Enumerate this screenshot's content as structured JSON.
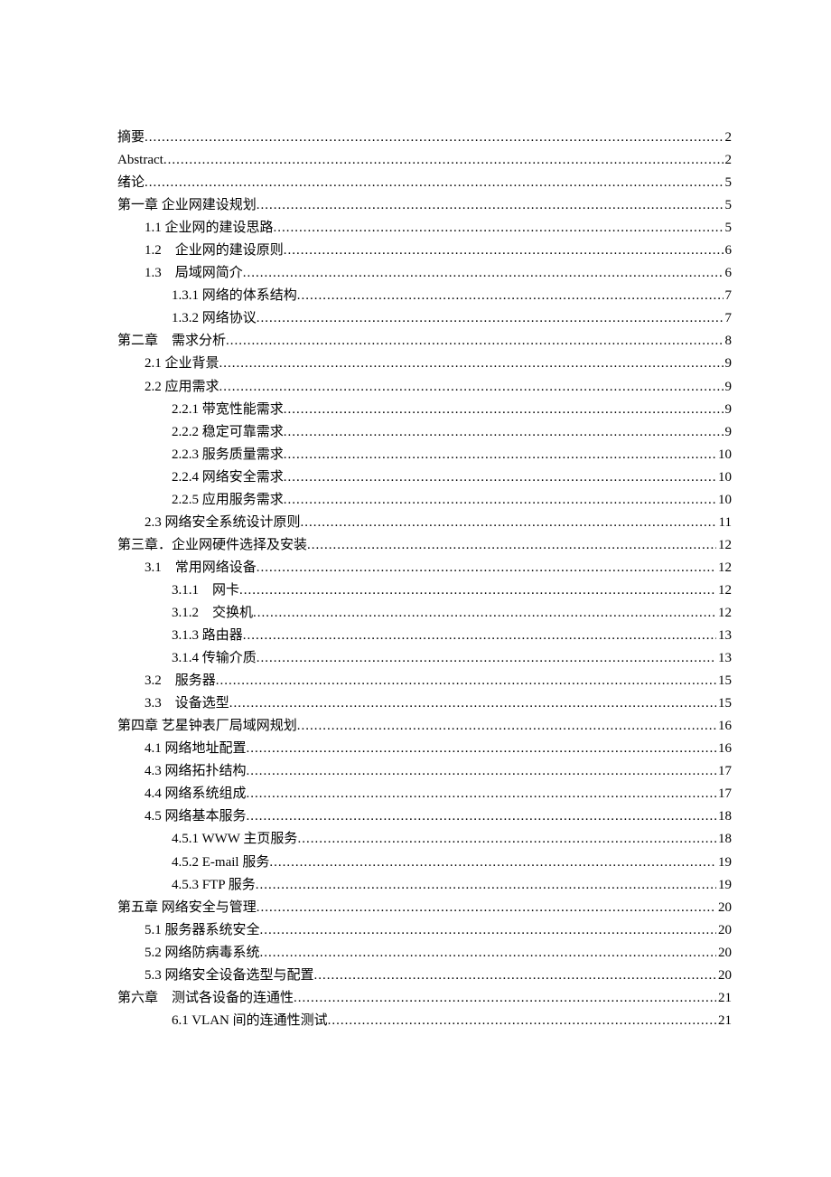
{
  "toc": [
    {
      "level": 0,
      "title": "摘要",
      "page": "2"
    },
    {
      "level": 0,
      "title": "Abstract",
      "page": "2"
    },
    {
      "level": 0,
      "title": "绪论",
      "page": "5"
    },
    {
      "level": 0,
      "title": "第一章 企业网建设规划",
      "page": "5"
    },
    {
      "level": 1,
      "title": "1.1 企业网的建设思路",
      "page": "5"
    },
    {
      "level": 1,
      "title": "1.2　企业网的建设原则",
      "page": "6"
    },
    {
      "level": 1,
      "title": "1.3　局域网简介",
      "page": "6"
    },
    {
      "level": 2,
      "title": "1.3.1 网络的体系结构",
      "page": "7"
    },
    {
      "level": 2,
      "title": "1.3.2 网络协议",
      "page": "7"
    },
    {
      "level": 0,
      "title": "第二章　需求分析",
      "page": "8"
    },
    {
      "level": 1,
      "title": "2.1 企业背景",
      "page": "9"
    },
    {
      "level": 1,
      "title": "2.2 应用需求",
      "page": "9"
    },
    {
      "level": 2,
      "title": "2.2.1 带宽性能需求",
      "page": "9"
    },
    {
      "level": 2,
      "title": "2.2.2 稳定可靠需求",
      "page": "9"
    },
    {
      "level": 2,
      "title": "2.2.3 服务质量需求",
      "page": "10"
    },
    {
      "level": 2,
      "title": "2.2.4 网络安全需求",
      "page": "10"
    },
    {
      "level": 2,
      "title": "2.2.5 应用服务需求",
      "page": "10"
    },
    {
      "level": 1,
      "title": "2.3 网络安全系统设计原则",
      "page": "11"
    },
    {
      "level": 0,
      "title": "第三章．企业网硬件选择及安装",
      "page": "12"
    },
    {
      "level": 1,
      "title": "3.1　常用网络设备",
      "page": "12"
    },
    {
      "level": 2,
      "title": "3.1.1　网卡",
      "page": "12"
    },
    {
      "level": 2,
      "title": "3.1.2　交换机",
      "page": "12"
    },
    {
      "level": 2,
      "title": "3.1.3 路由器",
      "page": "13"
    },
    {
      "level": 2,
      "title": "3.1.4 传输介质",
      "page": "13"
    },
    {
      "level": 1,
      "title": "3.2　服务器",
      "page": "15"
    },
    {
      "level": 1,
      "title": "3.3　设备选型",
      "page": "15"
    },
    {
      "level": 0,
      "title": "第四章 艺星钟表厂局域网规划",
      "page": "16"
    },
    {
      "level": 1,
      "title": "4.1 网络地址配置",
      "page": "16"
    },
    {
      "level": 1,
      "title": "4.3 网络拓扑结构",
      "page": "17"
    },
    {
      "level": 1,
      "title": "4.4 网络系统组成",
      "page": "17"
    },
    {
      "level": 1,
      "title": "4.5 网络基本服务",
      "page": "18"
    },
    {
      "level": 2,
      "title": "4.5.1 WWW 主页服务",
      "page": "18"
    },
    {
      "level": 2,
      "title": "4.5.2 E-mail 服务",
      "page": "19"
    },
    {
      "level": 2,
      "title": "4.5.3 FTP 服务",
      "page": "19"
    },
    {
      "level": 0,
      "title": "第五章 网络安全与管理",
      "page": "20"
    },
    {
      "level": 1,
      "title": "5.1 服务器系统安全",
      "page": "20"
    },
    {
      "level": 1,
      "title": "5.2 网络防病毒系统",
      "page": "20"
    },
    {
      "level": 1,
      "title": "5.3 网络安全设备选型与配置",
      "page": "20"
    },
    {
      "level": 0,
      "title": "第六章　测试各设备的连通性",
      "page": "21"
    },
    {
      "level": 2,
      "title": "6.1 VLAN 间的连通性测试",
      "page": "21"
    }
  ]
}
